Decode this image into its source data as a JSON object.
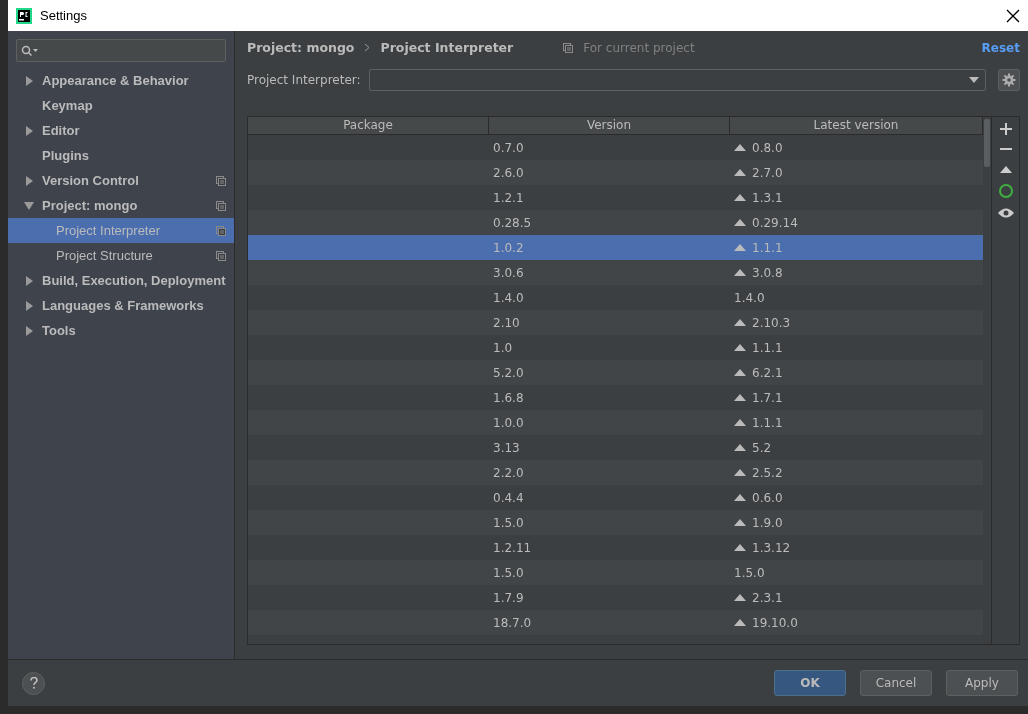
{
  "window": {
    "title": "Settings"
  },
  "sidebar": {
    "items": [
      {
        "label": "Appearance & Behavior",
        "expanded": false,
        "project_scoped": false,
        "selected": false
      },
      {
        "label": "Keymap",
        "project_scoped": false,
        "selected": false
      },
      {
        "label": "Editor",
        "expanded": false,
        "project_scoped": false,
        "selected": false
      },
      {
        "label": "Plugins",
        "project_scoped": false,
        "selected": false
      },
      {
        "label": "Version Control",
        "expanded": false,
        "project_scoped": true,
        "selected": false
      },
      {
        "label": "Project: mongo",
        "expanded": true,
        "project_scoped": true,
        "selected": false,
        "children": [
          {
            "label": "Project Interpreter",
            "project_scoped": true,
            "selected": true
          },
          {
            "label": "Project Structure",
            "project_scoped": true,
            "selected": false
          }
        ]
      },
      {
        "label": "Build, Execution, Deployment",
        "expanded": false,
        "project_scoped": false,
        "selected": false
      },
      {
        "label": "Languages & Frameworks",
        "expanded": false,
        "project_scoped": false,
        "selected": false
      },
      {
        "label": "Tools",
        "expanded": false,
        "project_scoped": false,
        "selected": false
      }
    ]
  },
  "breadcrumb": [
    "Project: mongo",
    "Project Interpreter"
  ],
  "scope_note": "For current project",
  "reset_link": "Reset",
  "interpreter": {
    "label": "Project Interpreter:"
  },
  "table": {
    "columns": [
      "Package",
      "Version",
      "Latest version"
    ],
    "rows": [
      {
        "version": "0.7.0",
        "latest": "0.8.0",
        "upgrade": true,
        "selected": false
      },
      {
        "version": "2.6.0",
        "latest": "2.7.0",
        "upgrade": true,
        "selected": false
      },
      {
        "version": "1.2.1",
        "latest": "1.3.1",
        "upgrade": true,
        "selected": false
      },
      {
        "version": "0.28.5",
        "latest": "0.29.14",
        "upgrade": true,
        "selected": false
      },
      {
        "version": "1.0.2",
        "latest": "1.1.1",
        "upgrade": true,
        "selected": true
      },
      {
        "version": "3.0.6",
        "latest": "3.0.8",
        "upgrade": true,
        "selected": false
      },
      {
        "version": "1.4.0",
        "latest": "1.4.0",
        "upgrade": false,
        "selected": false
      },
      {
        "version": "2.10",
        "latest": "2.10.3",
        "upgrade": true,
        "selected": false
      },
      {
        "version": "1.0",
        "latest": "1.1.1",
        "upgrade": true,
        "selected": false
      },
      {
        "version": "5.2.0",
        "latest": "6.2.1",
        "upgrade": true,
        "selected": false
      },
      {
        "version": "1.6.8",
        "latest": "1.7.1",
        "upgrade": true,
        "selected": false
      },
      {
        "version": "1.0.0",
        "latest": "1.1.1",
        "upgrade": true,
        "selected": false
      },
      {
        "version": "3.13",
        "latest": "5.2",
        "upgrade": true,
        "selected": false
      },
      {
        "version": "2.2.0",
        "latest": "2.5.2",
        "upgrade": true,
        "selected": false
      },
      {
        "version": "0.4.4",
        "latest": "0.6.0",
        "upgrade": true,
        "selected": false
      },
      {
        "version": "1.5.0",
        "latest": "1.9.0",
        "upgrade": true,
        "selected": false
      },
      {
        "version": "1.2.11",
        "latest": "1.3.12",
        "upgrade": true,
        "selected": false
      },
      {
        "version": "1.5.0",
        "latest": "1.5.0",
        "upgrade": false,
        "selected": false
      },
      {
        "version": "1.7.9",
        "latest": "2.3.1",
        "upgrade": true,
        "selected": false
      },
      {
        "version": "18.7.0",
        "latest": "19.10.0",
        "upgrade": true,
        "selected": false
      }
    ]
  },
  "buttons": [
    {
      "label": "OK",
      "kind": "primary"
    },
    {
      "label": "Cancel",
      "kind": "normal"
    },
    {
      "label": "Apply",
      "kind": "normal"
    }
  ]
}
